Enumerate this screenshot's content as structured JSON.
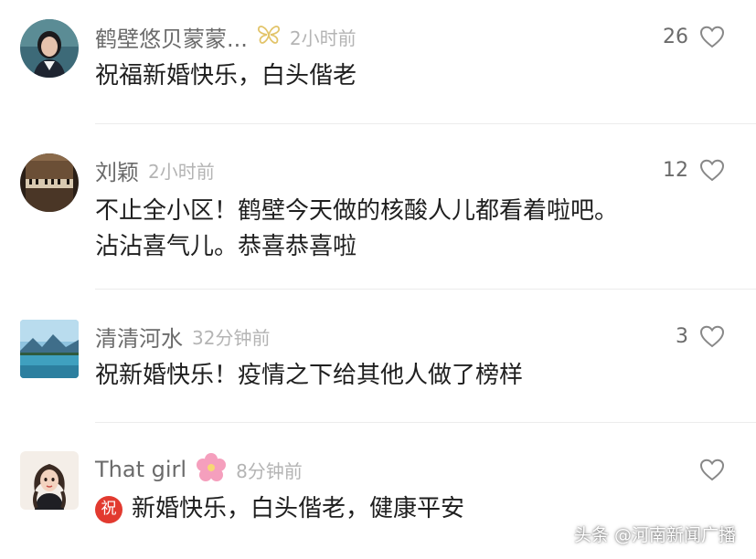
{
  "comments": [
    {
      "username": "鹤壁悠贝蒙蒙...",
      "time": "2小时前",
      "likes": "26",
      "text_lines": [
        "祝福新婚快乐，白头偕老"
      ],
      "badge_icon": "butterfly-icon",
      "avatar": "woman-portrait-avatar"
    },
    {
      "username": "刘颖",
      "time": "2小时前",
      "likes": "12",
      "text_lines": [
        "不止全小区！鹤壁今天做的核酸人儿都看着啦吧。",
        "沾沾喜气儿。恭喜恭喜啦"
      ],
      "avatar": "piano-avatar"
    },
    {
      "username": "清清河水",
      "time": "32分钟前",
      "likes": "3",
      "text_lines": [
        "祝新婚快乐！疫情之下给其他人做了榜样"
      ],
      "avatar": "lake-mountain-avatar"
    },
    {
      "username": "That girl",
      "time": "8分钟前",
      "likes": "",
      "text_lines": [
        "新婚快乐，白头偕老，健康平安"
      ],
      "badge_icon": "cherry-blossom-icon",
      "text_emoji": "祝",
      "avatar": "cartoon-girl-avatar"
    }
  ],
  "watermark": "头条 @河南新闻广播",
  "colors": {
    "username": "#6b6b6b",
    "timestamp": "#b4b4b4",
    "comment_text": "#1f1f1f",
    "divider": "#ececec",
    "zhu_badge": "#e23a2f",
    "blossom": "#f59fbd"
  }
}
